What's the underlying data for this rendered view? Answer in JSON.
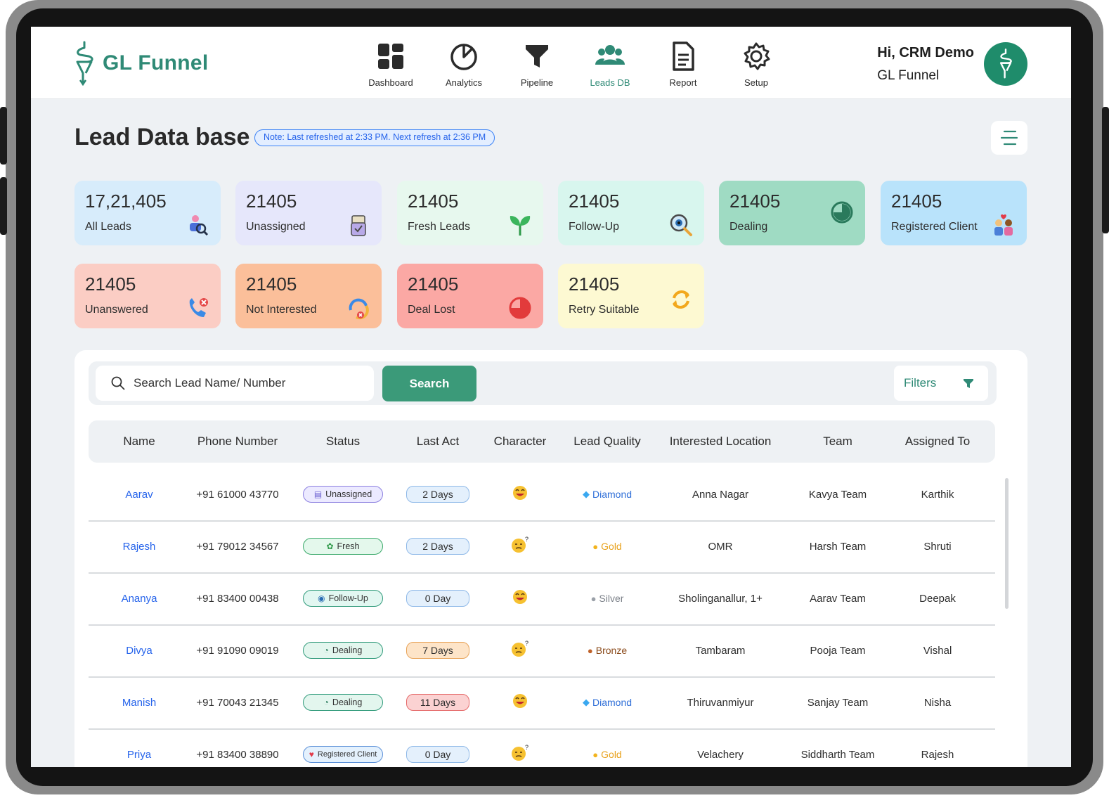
{
  "app": {
    "brand": "GL Funnel",
    "nav": [
      {
        "label": "Dashboard",
        "icon": "dashboard-icon",
        "active": false
      },
      {
        "label": "Analytics",
        "icon": "analytics-icon",
        "active": false
      },
      {
        "label": "Pipeline",
        "icon": "pipeline-icon",
        "active": false
      },
      {
        "label": "Leads DB",
        "icon": "leads-icon",
        "active": true
      },
      {
        "label": "Report",
        "icon": "report-icon",
        "active": false
      },
      {
        "label": "Setup",
        "icon": "setup-icon",
        "active": false
      }
    ],
    "user": {
      "greeting": "Hi, CRM Demo",
      "org": "GL Funnel"
    },
    "colors": {
      "brand": "#2f8a76",
      "button": "#3b9a79",
      "link": "#2563eb"
    }
  },
  "page": {
    "title": "Lead Data base",
    "note": "Note: Last refreshed at 2:33 PM. Next refresh at 2:36 PM"
  },
  "stats": [
    {
      "value": "17,21,405",
      "label": "All Leads",
      "color": "#d7ecfb",
      "icon": "all-leads-icon"
    },
    {
      "value": "21405",
      "label": "Unassigned",
      "color": "#e6e7fb",
      "icon": "unassigned-icon"
    },
    {
      "value": "21405",
      "label": "Fresh Leads",
      "color": "#e7f8ee",
      "icon": "sprout-icon"
    },
    {
      "value": "21405",
      "label": "Follow-Up",
      "color": "#d8f6ee",
      "icon": "magnifier-icon"
    },
    {
      "value": "21405",
      "label": "Dealing",
      "color": "#9fdbc3",
      "icon": "pie-icon"
    },
    {
      "value": "21405",
      "label": "Registered Client",
      "color": "#b9e3fb",
      "icon": "clients-icon"
    },
    {
      "value": "21405",
      "label": "Unanswered",
      "color": "#fbcdc4",
      "icon": "missed-call-icon"
    },
    {
      "value": "21405",
      "label": "Not Interested",
      "color": "#fbbf9a",
      "icon": "not-interested-icon"
    },
    {
      "value": "21405",
      "label": "Deal Lost",
      "color": "#fba8a4",
      "icon": "deal-lost-icon"
    },
    {
      "value": "21405",
      "label": "Retry Suitable",
      "color": "#fdf9d2",
      "icon": "retry-icon"
    }
  ],
  "search": {
    "placeholder": "Search Lead Name/ Number",
    "button": "Search",
    "filters": "Filters"
  },
  "table": {
    "columns": [
      "Name",
      "Phone Number",
      "Status",
      "Last Act",
      "Character",
      "Lead Quality",
      "Interested Location",
      "Team",
      "Assigned To"
    ],
    "rows": [
      {
        "name": "Aarav",
        "phone": "+91 61000 43770",
        "status": "Unassigned",
        "last_act": "2 Days",
        "character": "happy",
        "quality": "Diamond",
        "location": "Anna Nagar",
        "team": "Kavya Team",
        "assigned": "Karthik"
      },
      {
        "name": "Rajesh",
        "phone": "+91 79012 34567",
        "status": "Fresh",
        "last_act": "2 Days",
        "character": "doubtful",
        "quality": "Gold",
        "location": "OMR",
        "team": "Harsh Team",
        "assigned": "Shruti"
      },
      {
        "name": "Ananya",
        "phone": "+91 83400 00438",
        "status": "Follow-Up",
        "last_act": "0 Day",
        "character": "happy",
        "quality": "Silver",
        "location": "Sholinganallur, 1+",
        "team": "Aarav Team",
        "assigned": "Deepak"
      },
      {
        "name": "Divya",
        "phone": "+91 91090 09019",
        "status": "Dealing",
        "last_act": "7 Days",
        "character": "doubtful",
        "quality": "Bronze",
        "location": "Tambaram",
        "team": "Pooja Team",
        "assigned": "Vishal"
      },
      {
        "name": "Manish",
        "phone": "+91 70043 21345",
        "status": "Dealing",
        "last_act": "11 Days",
        "character": "happy",
        "quality": "Diamond",
        "location": "Thiruvanmiyur",
        "team": "Sanjay Team",
        "assigned": "Nisha"
      },
      {
        "name": "Priya",
        "phone": "+91 83400 38890",
        "status": "Registered Client",
        "last_act": "0 Day",
        "character": "doubtful",
        "quality": "Gold",
        "location": "Velachery",
        "team": "Siddharth Team",
        "assigned": "Rajesh"
      }
    ]
  }
}
